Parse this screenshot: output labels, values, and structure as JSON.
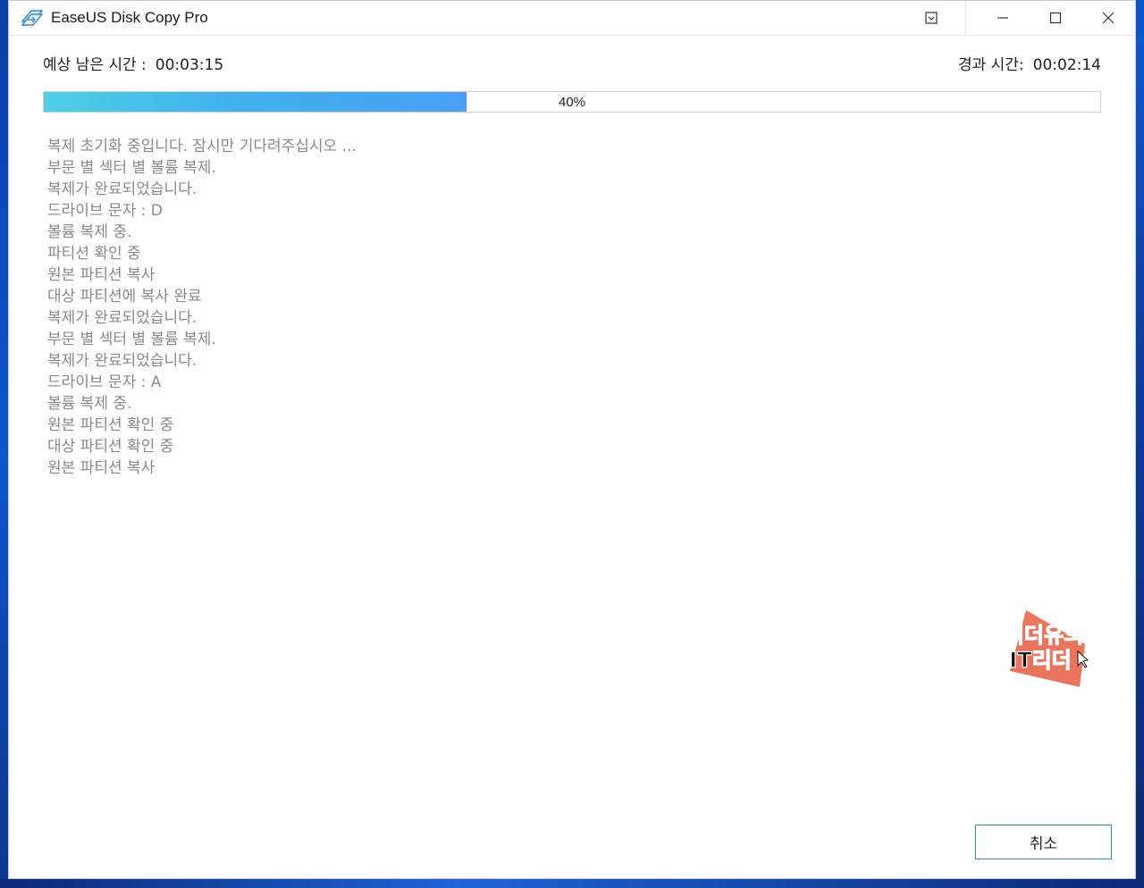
{
  "window": {
    "title": "EaseUS Disk Copy Pro"
  },
  "header": {
    "remaining_label": "예상 남은 시간 :",
    "remaining_value": "00:03:15",
    "elapsed_label": "경과 시간:",
    "elapsed_value": "00:02:14"
  },
  "progress": {
    "label": "40%",
    "value": 40,
    "fill_colors": [
      "#4fd0e6",
      "#4a9ff5"
    ]
  },
  "log": [
    "복제 초기화 중입니다. 잠시만 기다려주십시오 ...",
    "부문 별 섹터 별 볼륨 복제.",
    "복제가 완료되었습니다.",
    "드라이브 문자 : D",
    "볼륨 복제 중.",
    "파티션 확인 중",
    "원본 파티션 복사",
    "대상 파티션에 복사 완료",
    "복제가 완료되었습니다.",
    "부문 별 섹터 별 볼륨 복제.",
    "복제가 완료되었습니다.",
    "드라이브 문자 : A",
    "볼륨 복제 중.",
    "원본 파티션 확인 중",
    "대상 파티션 확인 중",
    "원본 파티션 복사"
  ],
  "watermark": {
    "line1": "리더유의",
    "line2": "IT리더"
  },
  "buttons": {
    "cancel": "취소"
  },
  "icons": {
    "app": "easeus-disk-copy-icon",
    "pin": "pin-icon",
    "minimize": "minimize-icon",
    "maximize": "maximize-icon",
    "close": "close-icon"
  },
  "colors": {
    "accent": "#2f86d6",
    "log_text": "#8a8a8a"
  }
}
